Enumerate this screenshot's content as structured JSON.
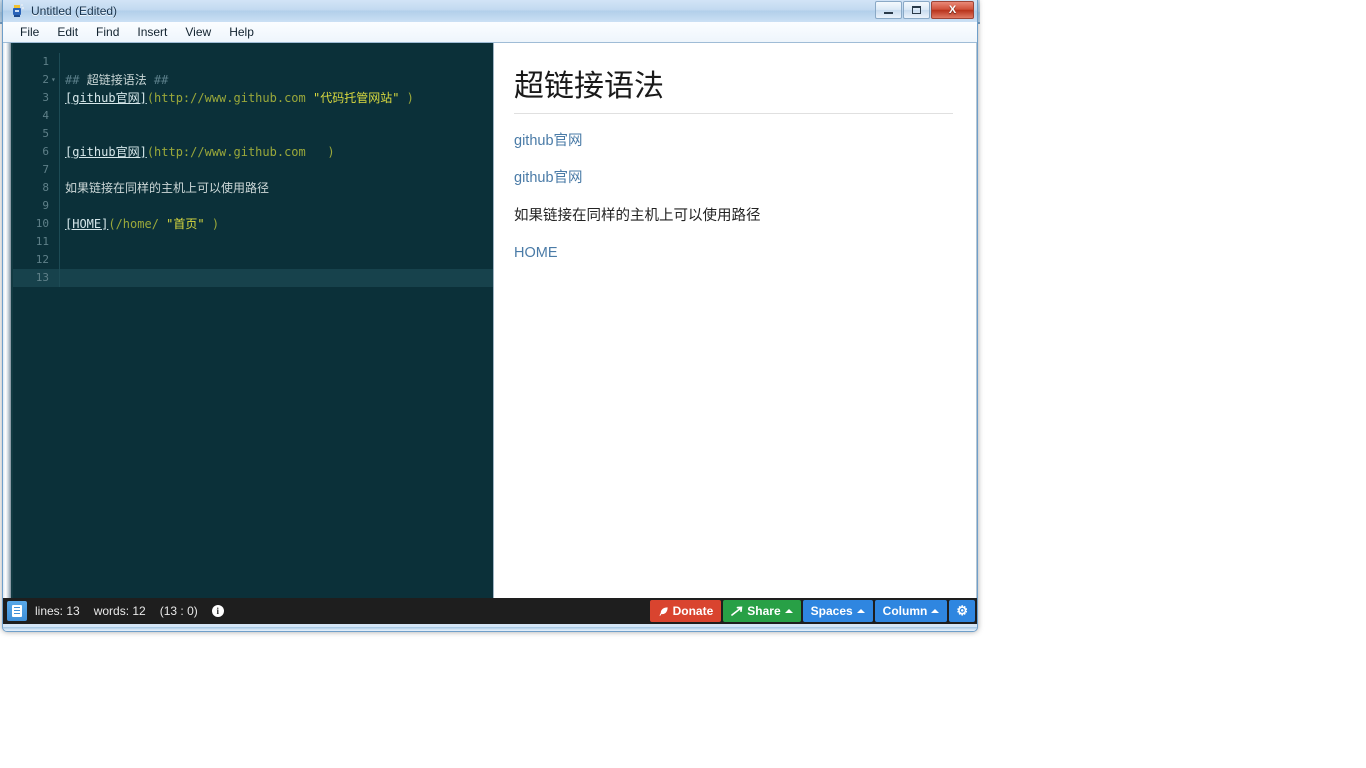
{
  "window": {
    "title": "Untitled (Edited)",
    "icon": "markdownpad-icon",
    "buttons": {
      "minimize": "minimize-button",
      "maximize": "maximize-button",
      "close": "X"
    }
  },
  "menubar": {
    "items": [
      {
        "label": "File"
      },
      {
        "label": "Edit"
      },
      {
        "label": "Find"
      },
      {
        "label": "Insert"
      },
      {
        "label": "View"
      },
      {
        "label": "Help"
      }
    ]
  },
  "editor": {
    "current_line": 13,
    "lines": [
      {
        "n": "1",
        "fold": "",
        "tokens": []
      },
      {
        "n": "2",
        "fold": "▾",
        "tokens": [
          {
            "t": "## ",
            "c": "tok-hash"
          },
          {
            "t": "超链接语法",
            "c": "tok-head"
          },
          {
            "t": " ##",
            "c": "tok-hash"
          }
        ]
      },
      {
        "n": "3",
        "fold": "",
        "tokens": [
          {
            "t": "[github官网]",
            "c": "tok-link"
          },
          {
            "t": "(http://www.github.com ",
            "c": "tok-url"
          },
          {
            "t": "\"代码托管网站\"",
            "c": "tok-title"
          },
          {
            "t": " )",
            "c": "tok-url"
          }
        ]
      },
      {
        "n": "4",
        "fold": "",
        "tokens": []
      },
      {
        "n": "5",
        "fold": "",
        "tokens": []
      },
      {
        "n": "6",
        "fold": "",
        "tokens": [
          {
            "t": "[github官网]",
            "c": "tok-link"
          },
          {
            "t": "(http://www.github.com   )",
            "c": "tok-url"
          }
        ]
      },
      {
        "n": "7",
        "fold": "",
        "tokens": []
      },
      {
        "n": "8",
        "fold": "",
        "tokens": [
          {
            "t": "如果链接在同样的主机上可以使用路径",
            "c": "tok-plain"
          }
        ]
      },
      {
        "n": "9",
        "fold": "",
        "tokens": []
      },
      {
        "n": "10",
        "fold": "",
        "tokens": [
          {
            "t": "[HOME]",
            "c": "tok-link"
          },
          {
            "t": "(/home/ ",
            "c": "tok-url"
          },
          {
            "t": "\"首页\"",
            "c": "tok-title"
          },
          {
            "t": " )",
            "c": "tok-url"
          }
        ]
      },
      {
        "n": "11",
        "fold": "",
        "tokens": []
      },
      {
        "n": "12",
        "fold": "",
        "tokens": []
      },
      {
        "n": "13",
        "fold": "",
        "tokens": []
      }
    ]
  },
  "preview": {
    "heading": "超链接语法",
    "blocks": [
      {
        "kind": "link",
        "text": "github官网"
      },
      {
        "kind": "link",
        "text": "github官网"
      },
      {
        "kind": "text",
        "text": "如果链接在同样的主机上可以使用路径"
      },
      {
        "kind": "link",
        "text": "HOME"
      }
    ]
  },
  "statusbar": {
    "doc_icon": "document-icon",
    "lines": "lines: 13",
    "words": "words: 12",
    "position": "(13 : 0)",
    "info_icon": "i",
    "buttons": {
      "donate": "Donate",
      "share": "Share",
      "spaces": "Spaces",
      "column": "Column",
      "settings": "⚙"
    }
  },
  "colors": {
    "editor_bg": "#0b3039",
    "current_line": "#17424c",
    "link_token": "#d6e7ea",
    "url_token": "#9aa83a",
    "title_token": "#d9d93f",
    "preview_link": "#4a7ba7",
    "donate": "#d9442f",
    "share": "#28a046",
    "blue_button": "#2f86e0",
    "statusbar_bg": "#1e1e1e"
  },
  "background_palette": [
    "#b6cfe8",
    "#7fa8cc",
    "#b6cfe8",
    "#111111",
    "#0a0a0a",
    "#dfeaf6",
    "#141414",
    "#6e737a",
    "#8e1c2b",
    "#c9243c",
    "#d9763d",
    "#e0e254",
    "#3fa862",
    "#3a95d0",
    "#3b45a8",
    "#7b3f95",
    "#2f8f66",
    "#c84a7a",
    "#e8d44a",
    "#5fb9d8"
  ]
}
